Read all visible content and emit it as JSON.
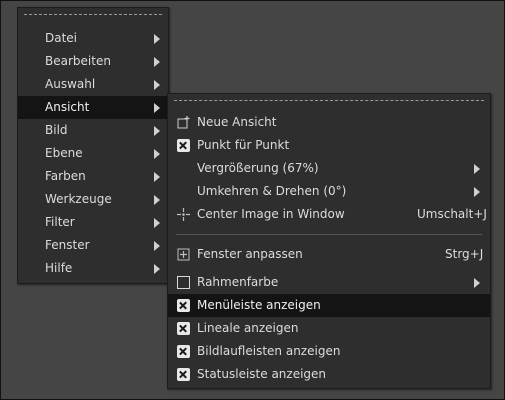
{
  "main_menu": {
    "items": [
      {
        "label": "Datei"
      },
      {
        "label": "Bearbeiten"
      },
      {
        "label": "Auswahl"
      },
      {
        "label": "Ansicht"
      },
      {
        "label": "Bild"
      },
      {
        "label": "Ebene"
      },
      {
        "label": "Farben"
      },
      {
        "label": "Werkzeuge"
      },
      {
        "label": "Filter"
      },
      {
        "label": "Fenster"
      },
      {
        "label": "Hilfe"
      }
    ]
  },
  "view_menu": {
    "new_view": "Neue Ansicht",
    "dot_for_dot": "Punkt für Punkt",
    "zoom": "Vergrößerung (67%)",
    "flip_rotate": "Umkehren  & Drehen (0°)",
    "center_image": "Center Image in Window",
    "center_image_shortcut": "Umschalt+J",
    "shrink_wrap": "Fenster anpassen",
    "shrink_wrap_shortcut": "Strg+J",
    "padding_color": "Rahmenfarbe",
    "show_menubar": "Menüleiste anzeigen",
    "show_rulers": "Lineale anzeigen",
    "show_scrollbars": "Bildlaufleisten anzeigen",
    "show_statusbar": "Statusleiste anzeigen"
  }
}
